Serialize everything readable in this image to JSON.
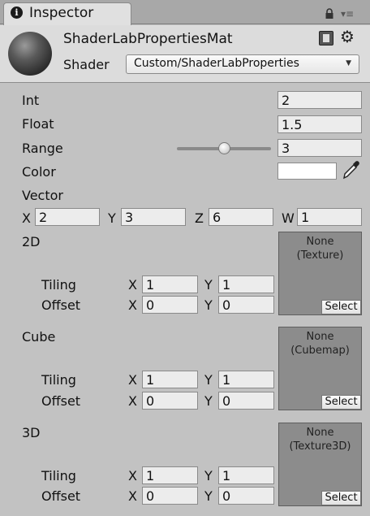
{
  "tab": {
    "title": "Inspector",
    "info_glyph": "i"
  },
  "header": {
    "material_name": "ShaderLabPropertiesMat",
    "shader_label": "Shader",
    "shader_value": "Custom/ShaderLabProperties",
    "dropdown_arrow": "▼",
    "settings_glyph": "⚙",
    "menu_glyph": "▾≡"
  },
  "props": {
    "int": {
      "label": "Int",
      "value": "2"
    },
    "float": {
      "label": "Float",
      "value": "1.5"
    },
    "range": {
      "label": "Range",
      "value": "3",
      "slider_fraction": 0.5
    },
    "color": {
      "label": "Color",
      "value": "#ffffff"
    },
    "vector": {
      "label": "Vector",
      "x_label": "X",
      "x": "2",
      "y_label": "Y",
      "y": "3",
      "z_label": "Z",
      "z": "6",
      "w_label": "W",
      "w": "1"
    }
  },
  "textures": [
    {
      "label": "2D",
      "tiling_label": "Tiling",
      "offset_label": "Offset",
      "x_label": "X",
      "y_label": "Y",
      "tiling_x": "1",
      "tiling_y": "1",
      "offset_x": "0",
      "offset_y": "0",
      "slot_line1": "None",
      "slot_line2": "(Texture)",
      "select_label": "Select"
    },
    {
      "label": "Cube",
      "tiling_label": "Tiling",
      "offset_label": "Offset",
      "x_label": "X",
      "y_label": "Y",
      "tiling_x": "1",
      "tiling_y": "1",
      "offset_x": "0",
      "offset_y": "0",
      "slot_line1": "None",
      "slot_line2": "(Cubemap)",
      "select_label": "Select"
    },
    {
      "label": "3D",
      "tiling_label": "Tiling",
      "offset_label": "Offset",
      "x_label": "X",
      "y_label": "Y",
      "tiling_x": "1",
      "tiling_y": "1",
      "offset_x": "0",
      "offset_y": "0",
      "slot_line1": "None",
      "slot_line2": "(Texture3D)",
      "select_label": "Select"
    }
  ]
}
